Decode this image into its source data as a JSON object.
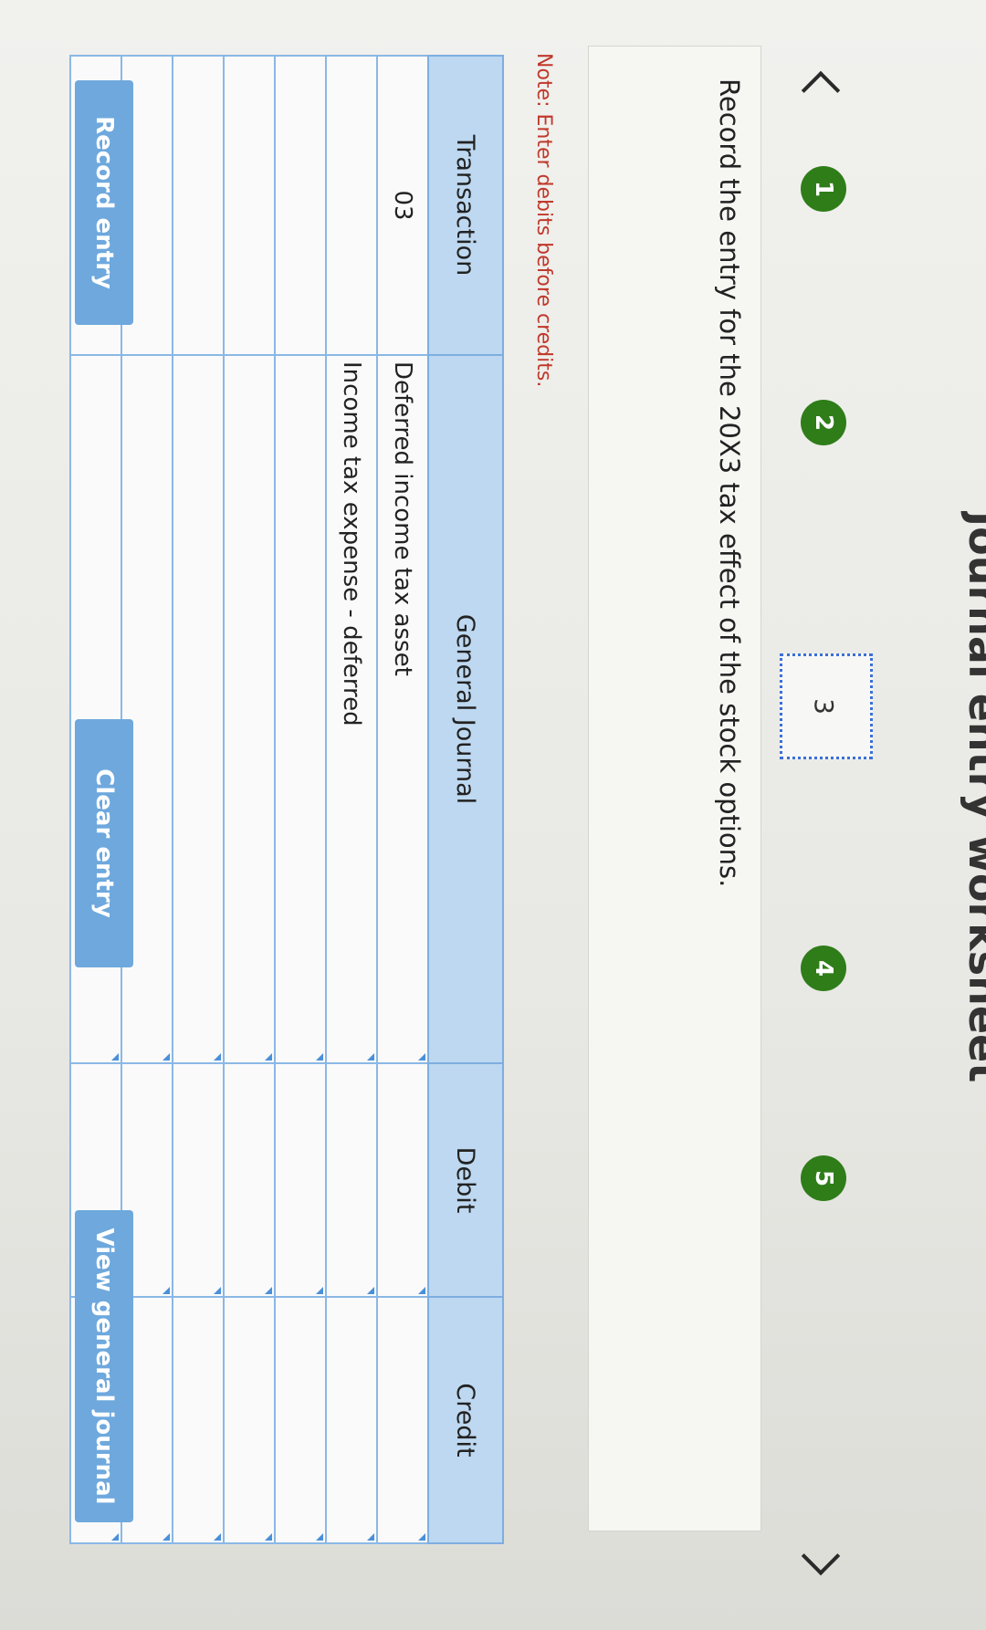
{
  "page": {
    "title": "Journal entry worksheet"
  },
  "steps": [
    {
      "number": "1",
      "completed": true
    },
    {
      "number": "2",
      "completed": true
    },
    {
      "number": "3",
      "completed": false,
      "active": true
    },
    {
      "number": "4",
      "completed": true
    },
    {
      "number": "5",
      "completed": true
    }
  ],
  "instruction": "Record the entry for the 20X3 tax effect of the stock options.",
  "note": "Note: Enter debits before credits.",
  "table": {
    "headers": [
      "Transaction",
      "General Journal",
      "Debit",
      "Credit"
    ],
    "rows": [
      {
        "transaction": "03",
        "account": "Deferred income tax asset",
        "debit": "",
        "credit": ""
      },
      {
        "transaction": "",
        "account": "Income tax expense - deferred",
        "debit": "",
        "credit": ""
      },
      {
        "transaction": "",
        "account": "",
        "debit": "",
        "credit": ""
      },
      {
        "transaction": "",
        "account": "",
        "debit": "",
        "credit": ""
      },
      {
        "transaction": "",
        "account": "",
        "debit": "",
        "credit": ""
      },
      {
        "transaction": "",
        "account": "",
        "debit": "",
        "credit": ""
      },
      {
        "transaction": "",
        "account": "",
        "debit": "",
        "credit": ""
      }
    ]
  },
  "buttons": {
    "record": "Record entry",
    "clear": "Clear entry",
    "view": "View general journal"
  },
  "colors": {
    "step_complete": "#2f7d19",
    "active_step_border": "#3b6fd8",
    "table_header": "#bdd8f0",
    "button": "#6ea8dd",
    "note": "#c0392b"
  }
}
